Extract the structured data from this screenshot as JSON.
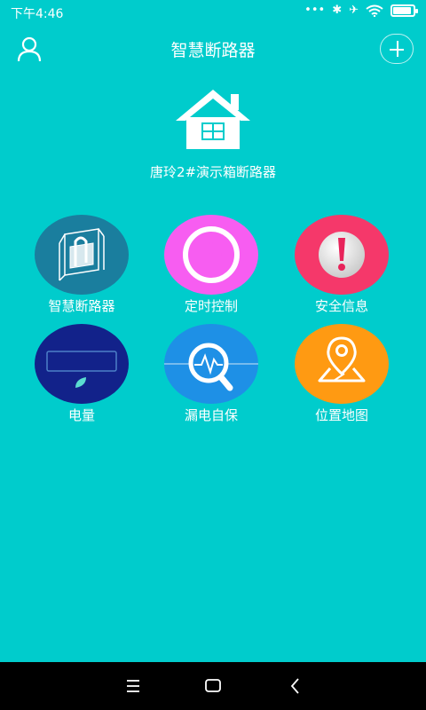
{
  "status_bar": {
    "time": "下午4:46",
    "dots": "•••",
    "bluetooth": "✱",
    "airplane": "✈",
    "wifi": "wifi",
    "battery_level_percent": 90
  },
  "header": {
    "title": "智慧断路器",
    "user_icon": "user-icon",
    "add_icon": "plus-icon"
  },
  "device": {
    "name": "唐玲2#演示箱断路器",
    "icon": "house-icon"
  },
  "menu": {
    "items": [
      {
        "label": "智慧断路器",
        "icon": "breaker-icon",
        "color": "#1a7e9e"
      },
      {
        "label": "定时控制",
        "icon": "clock-icon",
        "color": "#f75df1"
      },
      {
        "label": "安全信息",
        "icon": "alert-icon",
        "color": "#f5386a"
      },
      {
        "label": "电量",
        "icon": "energy-meter-icon",
        "color": "#12228a"
      },
      {
        "label": "漏电自保",
        "icon": "leakage-search-icon",
        "color": "#1e90e6"
      },
      {
        "label": "位置地图",
        "icon": "map-pin-icon",
        "color": "#ff9a12"
      }
    ]
  },
  "system_nav": {
    "menu_icon": "menu-icon",
    "home_icon": "home-icon",
    "back_icon": "back-icon"
  },
  "colors": {
    "background": "#00cccc",
    "text": "#ffffff",
    "system_bar": "#000000"
  }
}
